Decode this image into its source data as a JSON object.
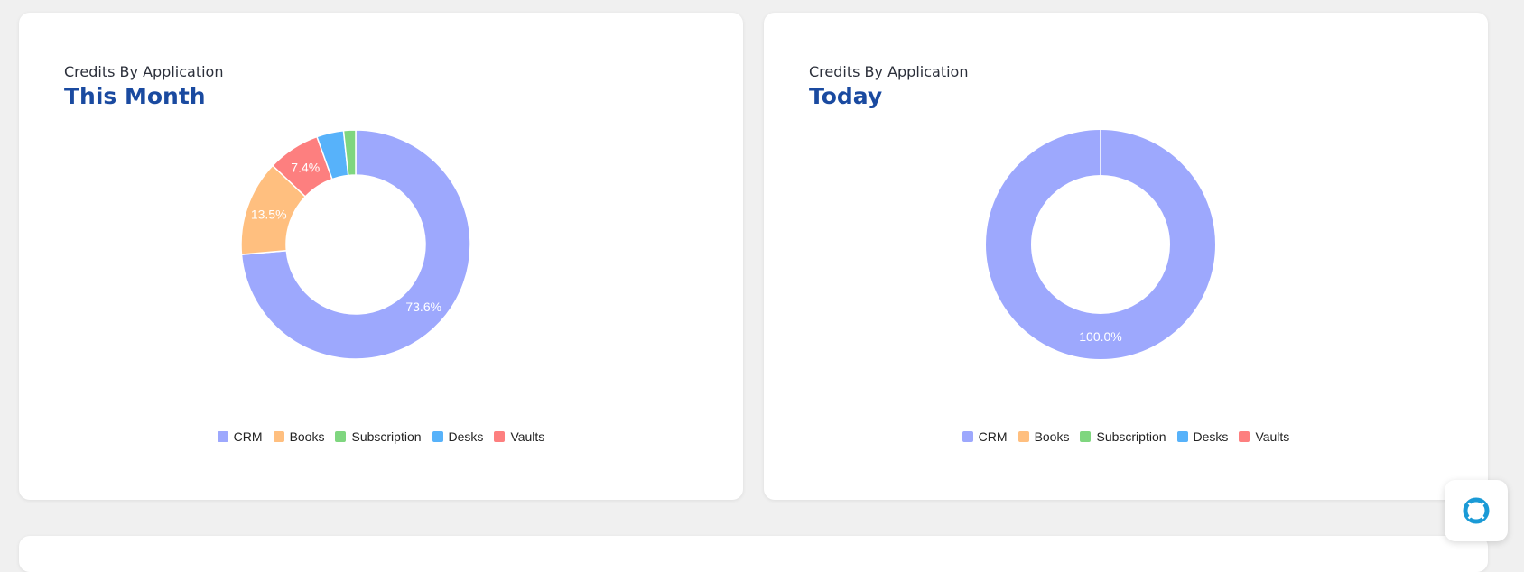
{
  "colors": {
    "CRM": "#9da8fd",
    "Books": "#ffbf7f",
    "Subscription": "#7fd67f",
    "Desks": "#57b2fa",
    "Vaults": "#fd7f7f",
    "title": "#1a4aa0",
    "help_icon": "#1a9ad6"
  },
  "help": {
    "icon": "lifebuoy-icon"
  },
  "chart_data": [
    {
      "type": "pie",
      "subtitle": "Credits By Application",
      "title": "This Month",
      "categories": [
        "CRM",
        "Books",
        "Subscription",
        "Desks",
        "Vaults"
      ],
      "series": [
        {
          "values": [
            73.6,
            13.5,
            1.7,
            3.8,
            7.4
          ]
        }
      ],
      "data_labels": [
        "73.6%",
        "13.5%",
        "",
        "",
        "7.4%"
      ],
      "legend": "bottom"
    },
    {
      "type": "pie",
      "subtitle": "Credits By Application",
      "title": "Today",
      "categories": [
        "CRM",
        "Books",
        "Subscription",
        "Desks",
        "Vaults"
      ],
      "series": [
        {
          "values": [
            100,
            0,
            0,
            0,
            0
          ]
        }
      ],
      "data_labels": [
        "100.0%",
        "",
        "",
        "",
        ""
      ],
      "legend": "bottom"
    }
  ]
}
